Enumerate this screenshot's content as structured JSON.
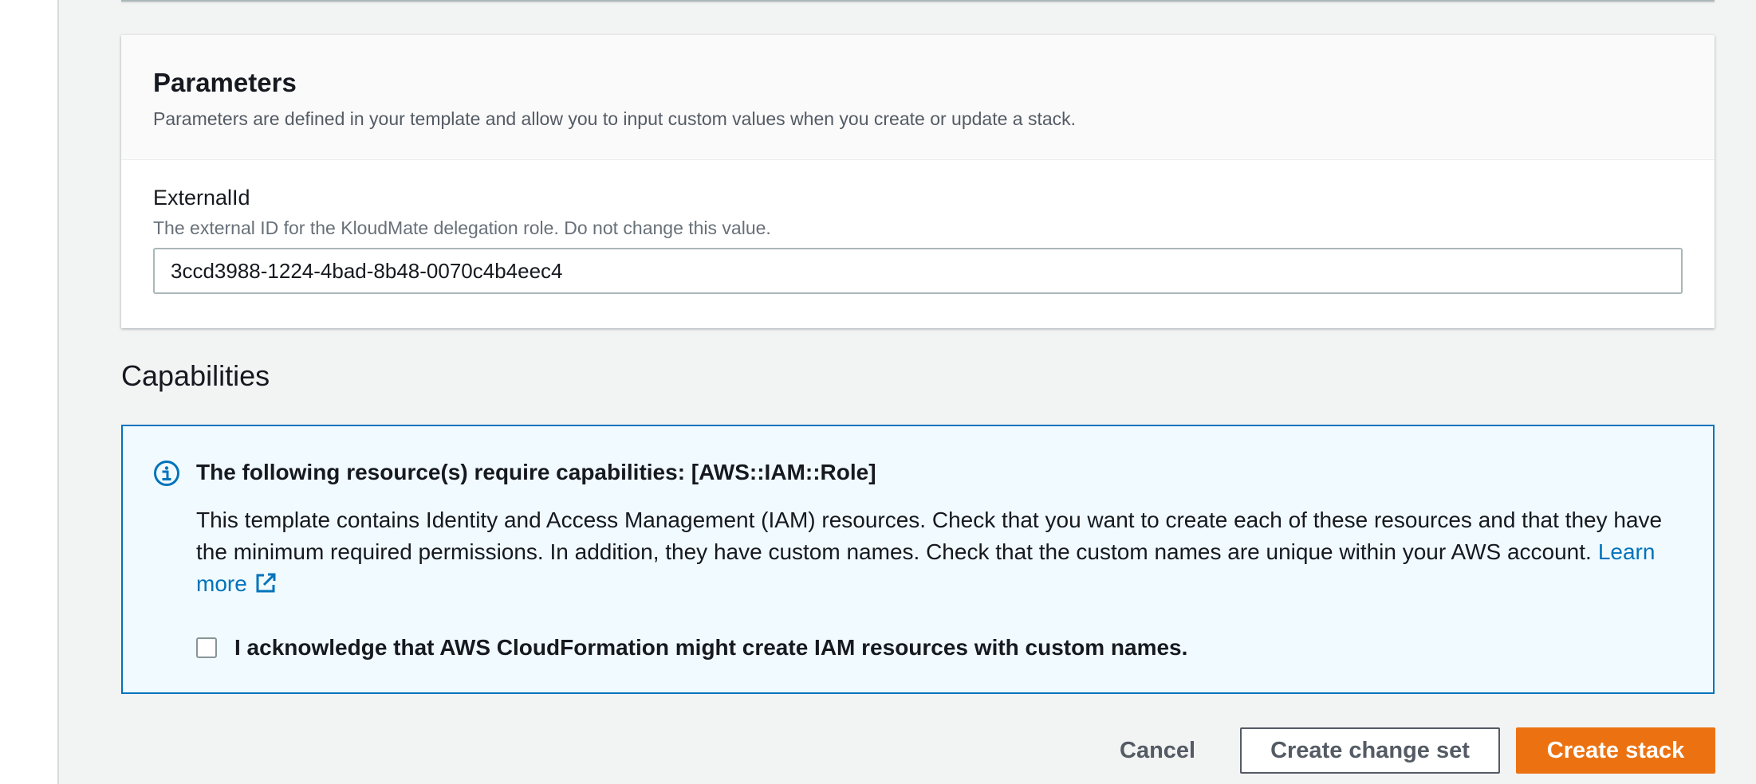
{
  "parameters": {
    "title": "Parameters",
    "description": "Parameters are defined in your template and allow you to input custom values when you create or update a stack.",
    "field": {
      "label": "ExternalId",
      "description": "The external ID for the KloudMate delegation role. Do not change this value.",
      "value": "3ccd3988-1224-4bad-8b48-0070c4b4eec4"
    }
  },
  "capabilities": {
    "title": "Capabilities",
    "alert": {
      "icon": "info-icon",
      "heading": "The following resource(s) require capabilities: [AWS::IAM::Role]",
      "text": "This template contains Identity and Access Management (IAM) resources. Check that you want to create each of these resources and that they have the minimum required permissions. In addition, they have custom names. Check that the custom names are unique within your AWS account.",
      "learn_more": "Learn more",
      "link_icon": "external-link-icon",
      "acknowledge_label": "I acknowledge that AWS CloudFormation might create IAM resources with custom names.",
      "acknowledged": false
    }
  },
  "footer": {
    "cancel_label": "Cancel",
    "change_set_label": "Create change set",
    "create_label": "Create stack"
  },
  "colors": {
    "accent": "#ec7211",
    "link": "#0073bb",
    "alert_bg": "#f1faff"
  }
}
